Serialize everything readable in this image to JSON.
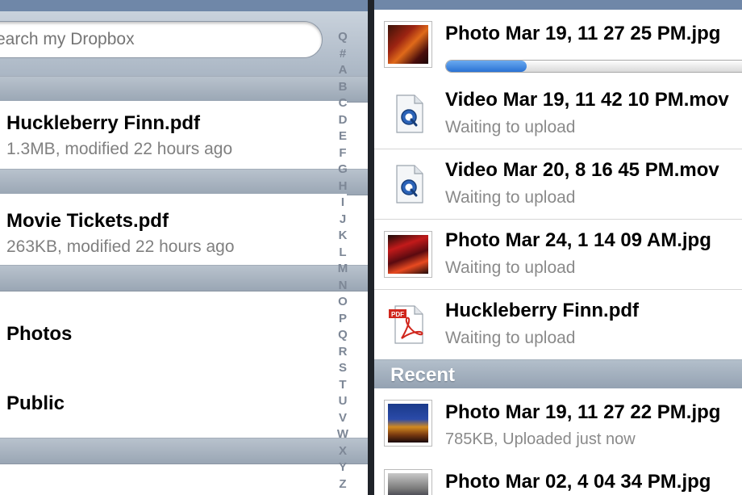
{
  "search": {
    "placeholder": "earch my Dropbox"
  },
  "index_letters": [
    "Q",
    "#",
    "A",
    "B",
    "C",
    "D",
    "E",
    "F",
    "G",
    "H",
    "I",
    "J",
    "K",
    "L",
    "M",
    "N",
    "O",
    "P",
    "Q",
    "R",
    "S",
    "T",
    "U",
    "V",
    "W",
    "X",
    "Y",
    "Z"
  ],
  "left_files": [
    {
      "title": "Huckleberry Finn.pdf",
      "subtitle": "1.3MB, modified 22 hours ago"
    },
    {
      "title": "Movie Tickets.pdf",
      "subtitle": "263KB, modified 22 hours ago"
    }
  ],
  "left_folders": [
    {
      "title": "Photos"
    },
    {
      "title": "Public"
    }
  ],
  "uploads": [
    {
      "name": "Photo Mar 19, 11 27 25 PM.jpg",
      "status": "",
      "progress": 0.25,
      "icon": "photo-thumbnail"
    },
    {
      "name": "Video Mar 19, 11 42 10 PM.mov",
      "status": "Waiting to upload",
      "icon": "quicktime-file-icon"
    },
    {
      "name": "Video Mar 20, 8 16 45 PM.mov",
      "status": "Waiting to upload",
      "icon": "quicktime-file-icon"
    },
    {
      "name": "Photo Mar 24, 1 14 09 AM.jpg",
      "status": "Waiting to upload",
      "icon": "photo-thumbnail"
    },
    {
      "name": "Huckleberry Finn.pdf",
      "status": "Waiting to upload",
      "icon": "pdf-file-icon"
    }
  ],
  "recent": {
    "label": "Recent",
    "items": [
      {
        "name": "Photo Mar 19, 11 27 22 PM.jpg",
        "status": "785KB, Uploaded just now"
      },
      {
        "name": "Photo Mar 02, 4 04 34 PM.jpg",
        "status": ""
      }
    ]
  },
  "pdf_badge": "PDF",
  "colors": {
    "nav_bar": "#6f87a8",
    "progress_fill": "#2a72d4",
    "section_bar": "#9aa6b4"
  }
}
